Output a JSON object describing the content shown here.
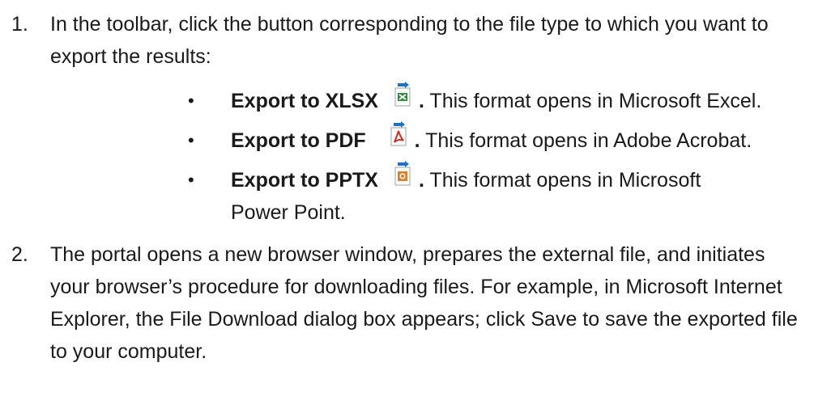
{
  "steps": [
    {
      "number": "1.",
      "text": "In the toolbar, click the button corresponding to the file type to which you want to export the results:"
    },
    {
      "number": "2.",
      "text": "The portal opens a new browser window, prepares the external file, and initiates your browser’s procedure for downloading files. For example, in Microsoft Internet Explorer, the File Download dialog box appears; click Save to save the exported file to your computer."
    }
  ],
  "bullets": [
    {
      "label": "Export to XLSX",
      "period": ".",
      "description": "This format opens in Microsoft Excel.",
      "icon": "excel-export-icon",
      "icon_color": "#2e8b3a"
    },
    {
      "label": "Export to PDF",
      "period": ".",
      "description": "This format opens in Adobe Acrobat.",
      "icon": "pdf-export-icon",
      "icon_color": "#d32b1e"
    },
    {
      "label": "Export to PPTX",
      "period": ".",
      "description": "This format opens in Microsoft Power Point.",
      "icon": "powerpoint-export-icon",
      "icon_color": "#d9822b"
    }
  ],
  "bullet_char": "•",
  "colors": {
    "arrow": "#1e73c8"
  }
}
